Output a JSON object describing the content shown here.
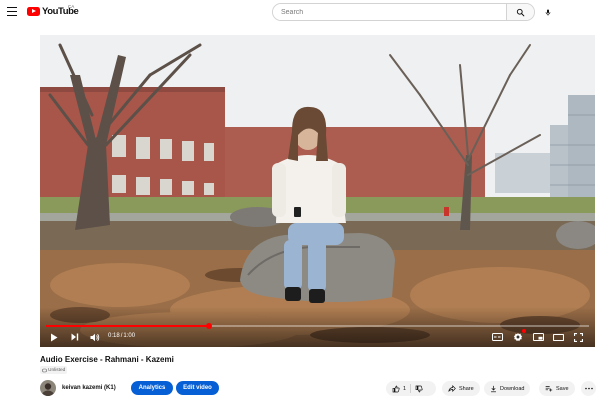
{
  "header": {
    "logo_text": "YouTube",
    "region_code": "CA",
    "search_placeholder": "Search",
    "search_value": ""
  },
  "player": {
    "current_time": "0:18",
    "time_separator": "/",
    "duration": "1:00",
    "progress_fraction": 0.3,
    "accent_color": "#ff0000"
  },
  "video": {
    "title": "Audio Exercise - Rahmani - Kazemi",
    "visibility": "Unlisted",
    "channel_name": "keivan kazemi (K1)",
    "analytics_label": "Analytics",
    "edit_label": "Edit video",
    "like_count": "1",
    "share_label": "Share",
    "download_label": "Download",
    "save_label": "Save"
  },
  "icons": [
    "menu-icon",
    "youtube-logo-icon",
    "search-icon",
    "microphone-icon",
    "play-icon",
    "next-icon",
    "volume-icon",
    "captions-icon",
    "settings-icon",
    "miniplayer-icon",
    "theater-icon",
    "fullscreen-icon",
    "lock-icon",
    "thumbs-up-icon",
    "thumbs-down-icon",
    "share-icon",
    "download-icon",
    "save-icon",
    "more-icon"
  ],
  "colors": {
    "brand_red": "#ff0000",
    "button_blue": "#065fd4",
    "pill_grey": "#f2f2f2"
  }
}
